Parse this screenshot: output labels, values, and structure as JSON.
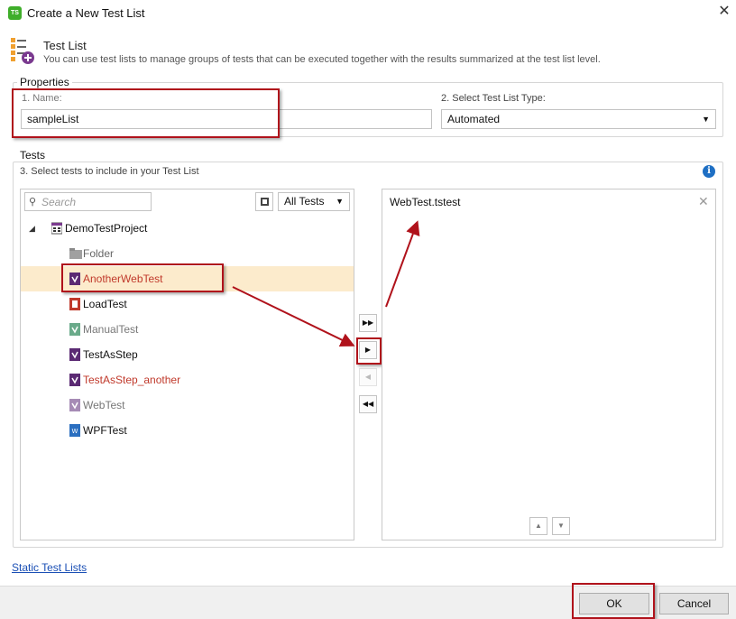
{
  "window": {
    "title": "Create a New Test List",
    "app_icon_text": "TS"
  },
  "header": {
    "title": "Test List",
    "description": "You can use test lists to manage groups of tests that can be executed together with the results summarized at the test list level."
  },
  "properties": {
    "group_label": "Properties",
    "name_label": "1. Name:",
    "name_value": "sampleList",
    "type_label": "2.  Select Test List Type:",
    "type_value": "Automated"
  },
  "tests": {
    "group_label": "Tests",
    "instruction": "3.  Select tests to include in your Test List",
    "search_placeholder": "Search",
    "filter_value": "All Tests",
    "project": "DemoTestProject",
    "items": [
      {
        "label": "Folder",
        "kind": "folder",
        "color": "#666666"
      },
      {
        "label": "AnotherWebTest",
        "kind": "web",
        "color": "#c0392b",
        "selected": true
      },
      {
        "label": "LoadTest",
        "kind": "load",
        "color": "#111111"
      },
      {
        "label": "ManualTest",
        "kind": "manual",
        "color": "#777777"
      },
      {
        "label": "TestAsStep",
        "kind": "web",
        "color": "#111111"
      },
      {
        "label": "TestAsStep_another",
        "kind": "web",
        "color": "#c0392b"
      },
      {
        "label": "WebTest",
        "kind": "web-light",
        "color": "#777777"
      },
      {
        "label": "WPFTest",
        "kind": "wpf",
        "color": "#111111"
      }
    ],
    "selected_tests": [
      "WebTest.tstest"
    ]
  },
  "transfer_buttons": [
    {
      "name": "add-all-button",
      "glyph": "▶▶",
      "enabled": true
    },
    {
      "name": "add-selected-button",
      "glyph": "▶",
      "enabled": true
    },
    {
      "name": "remove-selected-button",
      "glyph": "◀",
      "enabled": false
    },
    {
      "name": "remove-all-button",
      "glyph": "◀◀",
      "enabled": true
    }
  ],
  "footer": {
    "static_link": "Static Test Lists",
    "ok_label": "OK",
    "cancel_label": "Cancel"
  },
  "colors": {
    "annotation_red": "#b0121b",
    "selection_bg": "#fcebcc",
    "link": "#1a4fb5"
  }
}
